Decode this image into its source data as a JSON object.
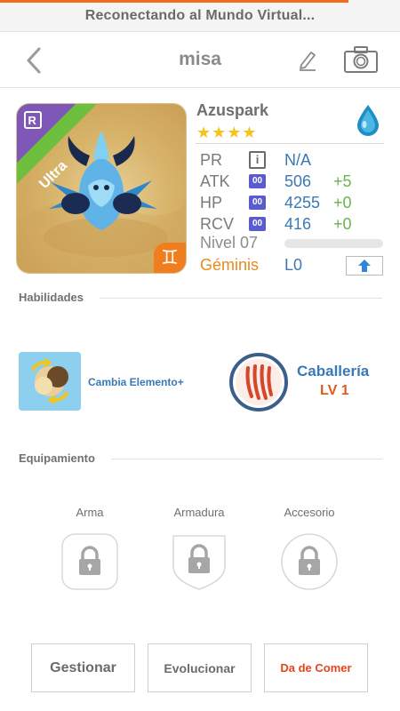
{
  "status": {
    "text": "Reconectando al Mundo Virtual...",
    "progress_fraction": 0.87,
    "accent_color": "#f26c22"
  },
  "nav": {
    "title": "misa",
    "back_icon": "chevron-left-icon",
    "edit_icon": "pencil-icon",
    "camera_icon": "camera-icon"
  },
  "monster": {
    "name": "Azuspark",
    "rarity_letter": "R",
    "rarity_label": "Ultra",
    "stars": "★★★★",
    "star_count": 4,
    "element_icon": "water-drop-icon",
    "type_symbol": "♊",
    "stats": [
      {
        "label": "PR",
        "chip": "i",
        "value": "N/A",
        "bonus": ""
      },
      {
        "label": "ATK",
        "chip": "00",
        "value": "506",
        "bonus": "+5"
      },
      {
        "label": "HP",
        "chip": "00",
        "value": "4255",
        "bonus": "+0"
      },
      {
        "label": "RCV",
        "chip": "00",
        "value": "416",
        "bonus": "+0"
      }
    ],
    "level_label": "Nivel 07",
    "level_progress_fraction": 0.0,
    "sign_label": "Géminis",
    "sign_value": "L0",
    "upgrade_icon": "arrow-up-icon"
  },
  "skills_section": {
    "title": "Habilidades",
    "active_skill_name": "Cambia Elemento+",
    "leader_skill_name": "Caballería",
    "leader_skill_level": "LV 1"
  },
  "equipment_section": {
    "title": "Equipamiento",
    "slots": [
      {
        "label": "Arma",
        "icon": "lock-icon"
      },
      {
        "label": "Armadura",
        "icon": "lock-icon"
      },
      {
        "label": "Accesorio",
        "icon": "lock-icon"
      }
    ]
  },
  "actions": {
    "manage": "Gestionar",
    "evolve": "Evolucionar",
    "feed": "Da de Comer"
  },
  "colors": {
    "blue_value": "#3a79b7",
    "green_bonus": "#69b54a",
    "orange": "#e68a1c",
    "feed_red": "#e8441a"
  }
}
